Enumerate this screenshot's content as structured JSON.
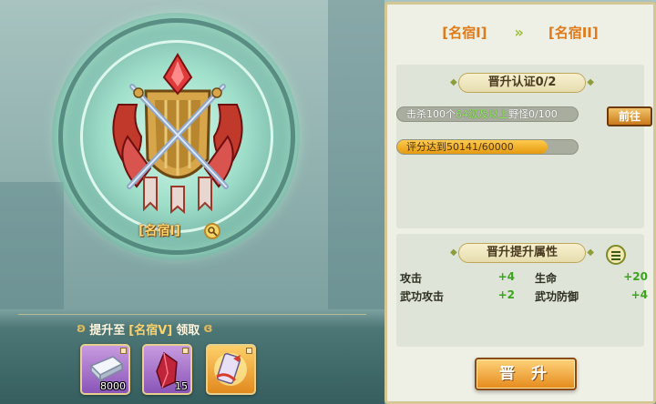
{
  "rank": {
    "current": "[名宿I]",
    "next": "[名宿II]",
    "emblem_label": "[名宿I]"
  },
  "reward": {
    "prefix": "提升至",
    "target": "[名宿V]",
    "suffix": "领取",
    "items": [
      {
        "icon": "silver-ingot-icon",
        "count": "8000"
      },
      {
        "icon": "red-crystal-icon",
        "count": "15"
      },
      {
        "icon": "treasure-map-icon",
        "count": ""
      }
    ]
  },
  "certification": {
    "title": "晋升认证0/2",
    "tasks": [
      {
        "text_pre": "击杀100个",
        "text_hl": "64级及以上",
        "text_post": "野怪0/100",
        "progress": 0,
        "button": "前往"
      },
      {
        "text_pre": "评分达到",
        "text_hl": "",
        "text_post": "50141/60000",
        "progress": 0.8357
      }
    ]
  },
  "attributes": {
    "title": "晋升提升属性",
    "rows": [
      {
        "name": "攻击",
        "value": "+4",
        "name2": "生命",
        "value2": "+20"
      },
      {
        "name": "武功攻击",
        "value": "+2",
        "name2": "武功防御",
        "value2": "+4"
      }
    ]
  },
  "actions": {
    "promote": "晋 升"
  },
  "colors": {
    "accent": "#e07a1a",
    "gain": "#3aa51c",
    "bar_fill": "#f0a820"
  }
}
